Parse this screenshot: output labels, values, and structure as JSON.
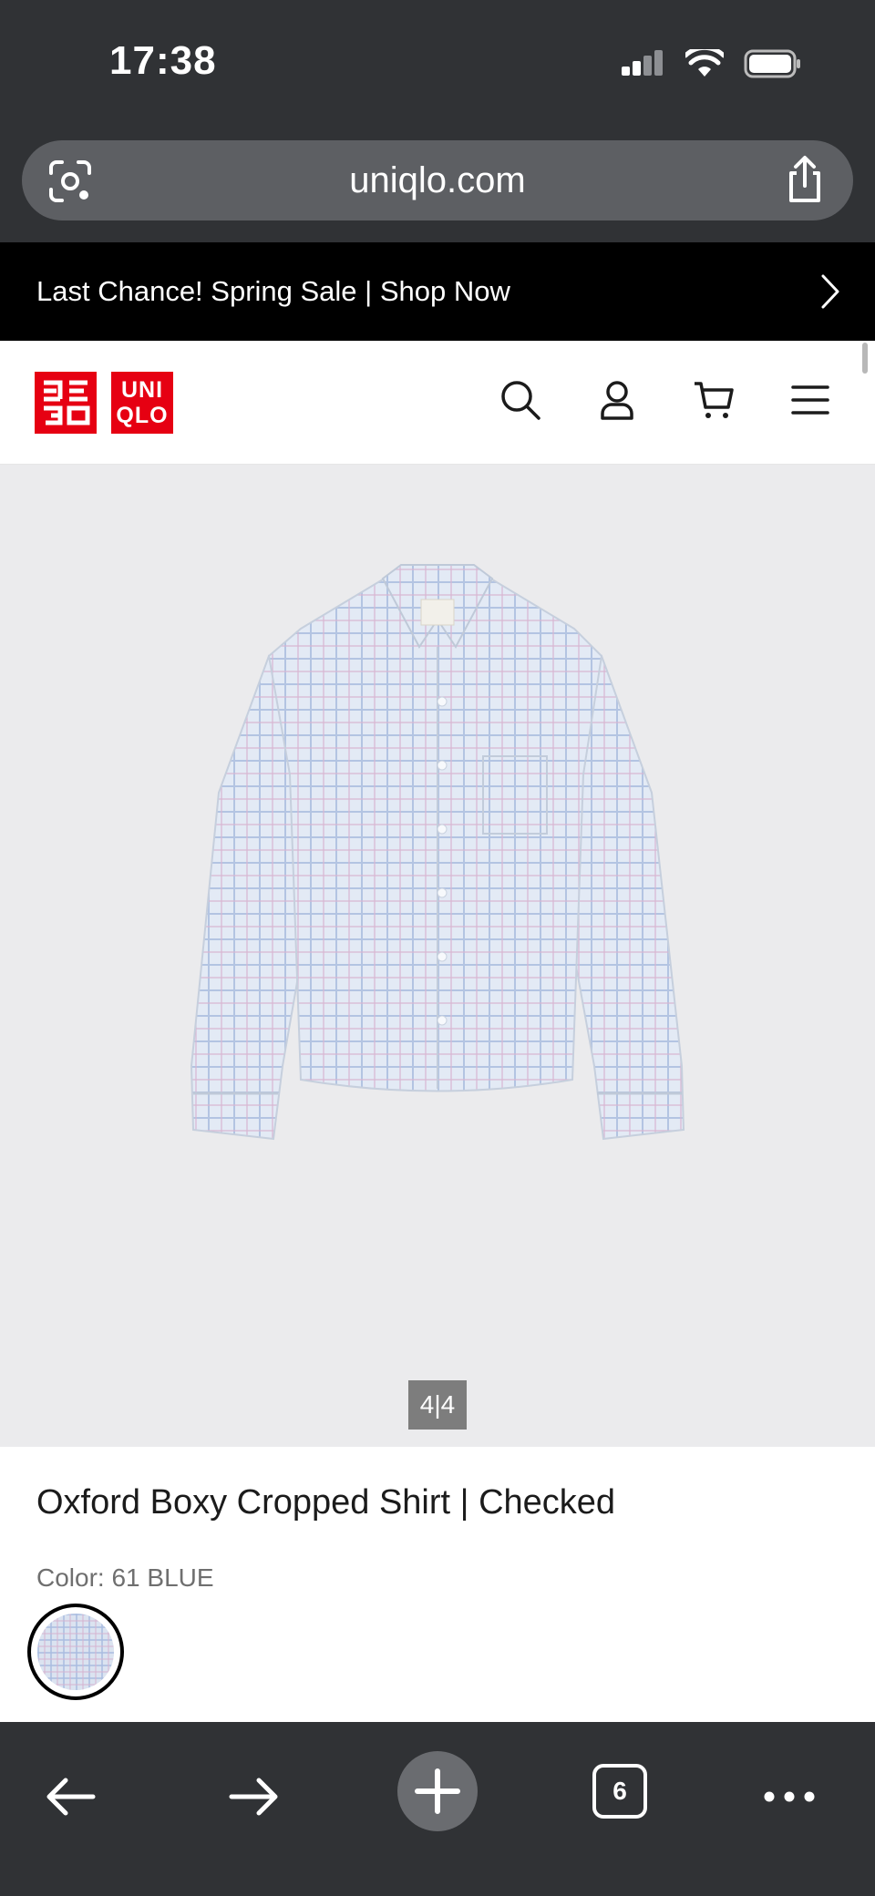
{
  "status_bar": {
    "time": "17:38",
    "icons": [
      "cellular-signal-icon",
      "wifi-icon",
      "battery-icon"
    ]
  },
  "browser": {
    "url": "uniqlo.com",
    "left_icon": "visual-search-icon",
    "right_icon": "share-icon",
    "tab_count": "6",
    "toolbar_icons": [
      "back-arrow-icon",
      "forward-arrow-icon",
      "plus-icon",
      "tabs-icon",
      "more-icon"
    ]
  },
  "promo_banner": {
    "text": "Last Chance! Spring Sale | Shop Now",
    "icon": "chevron-right-icon"
  },
  "header": {
    "logo_text": [
      "UNI",
      "QLO"
    ],
    "logo_katakana": [
      "ユニ",
      "クロ"
    ],
    "brand_color": "#e60012",
    "icons": [
      "search-icon",
      "account-icon",
      "cart-icon",
      "menu-icon"
    ]
  },
  "gallery": {
    "image_counter": "4|4",
    "image": "checked-shirt-product-photo"
  },
  "product": {
    "title": "Oxford Boxy Cropped Shirt | Checked",
    "color_label": "Color: 61 BLUE"
  }
}
